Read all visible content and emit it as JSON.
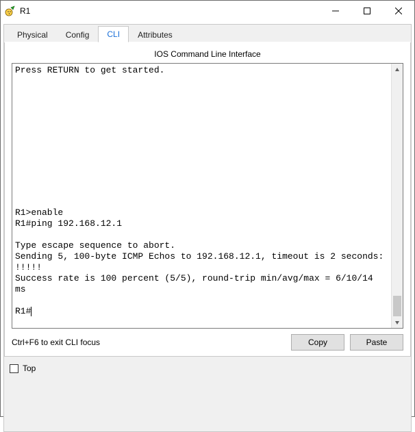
{
  "window": {
    "title": "R1"
  },
  "tabs": {
    "physical": "Physical",
    "config": "Config",
    "cli": "CLI",
    "attributes": "Attributes"
  },
  "panel": {
    "title": "IOS Command Line Interface"
  },
  "terminal": {
    "line_start": "Press RETURN to get started.",
    "blank": " ",
    "enable": "R1>enable",
    "ping": "R1#ping 192.168.12.1",
    "escape": "Type escape sequence to abort.",
    "sending": "Sending 5, 100-byte ICMP Echos to 192.168.12.1, timeout is 2 seconds:",
    "bangs": "!!!!!",
    "success": "Success rate is 100 percent (5/5), round-trip min/avg/max = 6/10/14 ms",
    "prompt": "R1#"
  },
  "hint": "Ctrl+F6 to exit CLI focus",
  "buttons": {
    "copy": "Copy",
    "paste": "Paste"
  },
  "footer": {
    "top_label": "Top"
  }
}
